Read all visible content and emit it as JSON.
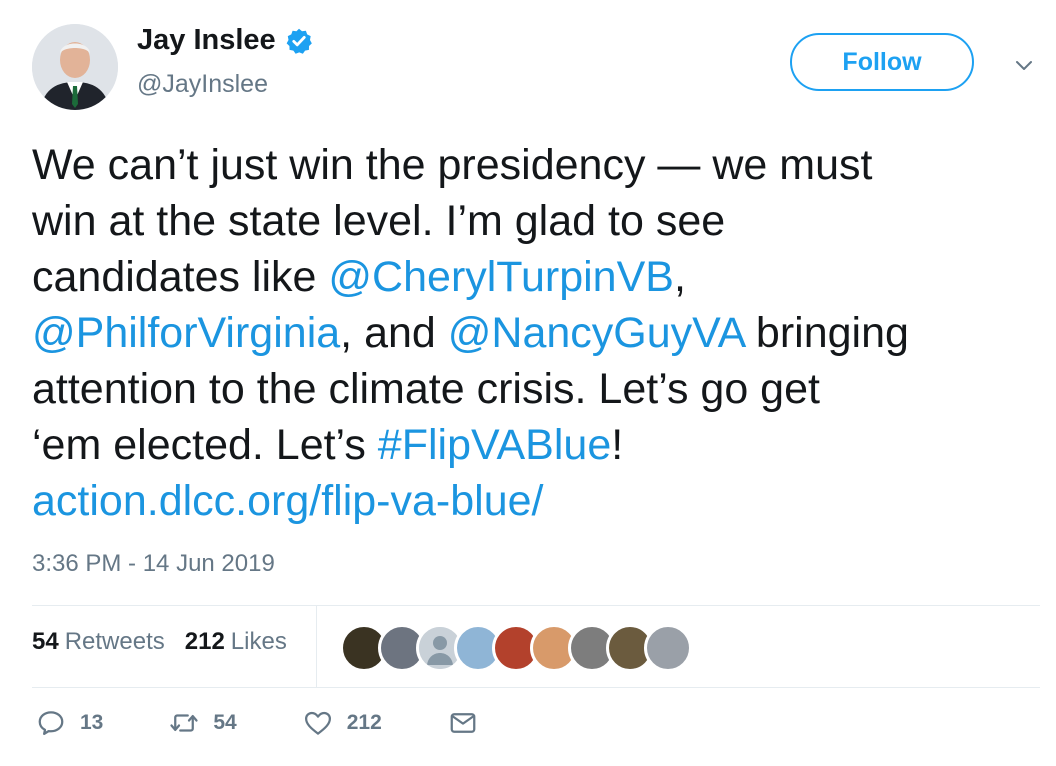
{
  "user": {
    "display_name": "Jay Inslee",
    "handle": "@JayInslee",
    "verified": true
  },
  "follow_label": "Follow",
  "tweet": {
    "lines": [
      [
        {
          "t": "We can’t just win the presidency — we must"
        }
      ],
      [
        {
          "t": "win at the state level. I’m glad to see"
        }
      ],
      [
        {
          "t": "candidates like "
        },
        {
          "t": "@CherylTurpinVB",
          "link": true
        },
        {
          "t": ","
        }
      ],
      [
        {
          "t": "@PhilforVirginia",
          "link": true
        },
        {
          "t": ", and "
        },
        {
          "t": "@NancyGuyVA",
          "link": true
        },
        {
          "t": " bringing"
        }
      ],
      [
        {
          "t": "attention to the climate crisis. Let’s go get"
        }
      ],
      [
        {
          "t": "‘em elected. Let’s "
        },
        {
          "t": "#FlipVABlue",
          "link": true
        },
        {
          "t": "!"
        }
      ],
      [
        {
          "t": "action.dlcc.org/flip-va-blue/",
          "link": true
        }
      ]
    ]
  },
  "timestamp": "3:36 PM - 14 Jun 2019",
  "stats": {
    "retweets_count": "54",
    "retweets_label": "Retweets",
    "likes_count": "212",
    "likes_label": "Likes"
  },
  "liker_avatar_colors": [
    "#3a3322",
    "#6d7480",
    "#c9d1d8",
    "#8fb5d6",
    "#b3412c",
    "#d89a6a",
    "#7d7d7d",
    "#6b5b3e",
    "#9aa0a8"
  ],
  "actions": {
    "reply_count": "13",
    "retweet_count": "54",
    "like_count": "212"
  },
  "colors": {
    "accent": "#1da1f2",
    "link": "#1b95e0",
    "muted": "#657786"
  }
}
